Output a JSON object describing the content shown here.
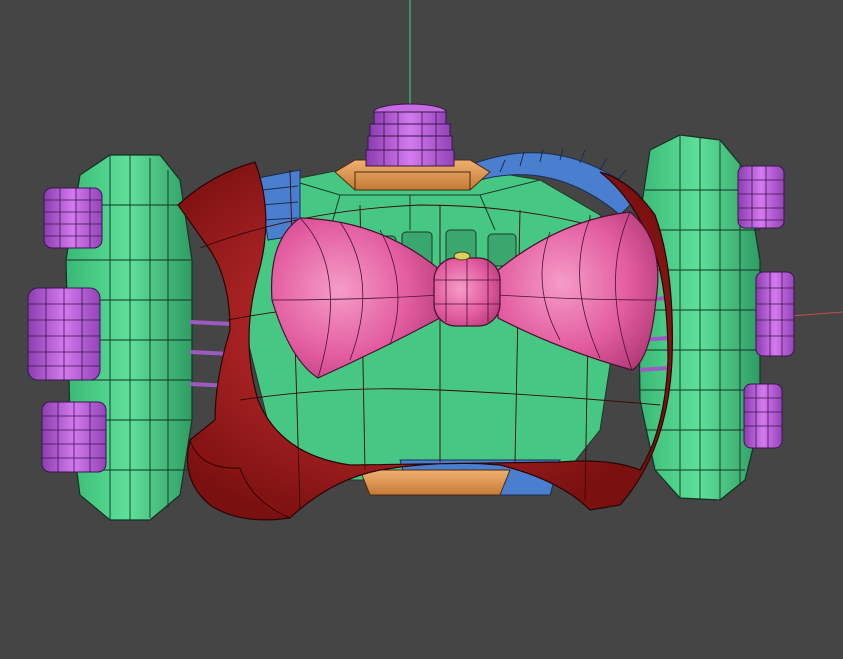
{
  "viewport": {
    "background": "#454545",
    "axis_colors": {
      "y": "#3fbf7a",
      "x": "#c0504d"
    }
  },
  "model": {
    "colors": {
      "frame_green": "#4fd58f",
      "frame_green_dark": "#2e9a64",
      "bolt_purple": "#c56be0",
      "bolt_purple_dark": "#8e3eae",
      "shell_red": "#b01c1c",
      "shell_red_dark": "#6e0e0e",
      "bow_pink": "#e55aa0",
      "bow_pink_dark": "#a13470",
      "gear_blue": "#4a7fd0",
      "plate_orange": "#e1964c"
    }
  }
}
